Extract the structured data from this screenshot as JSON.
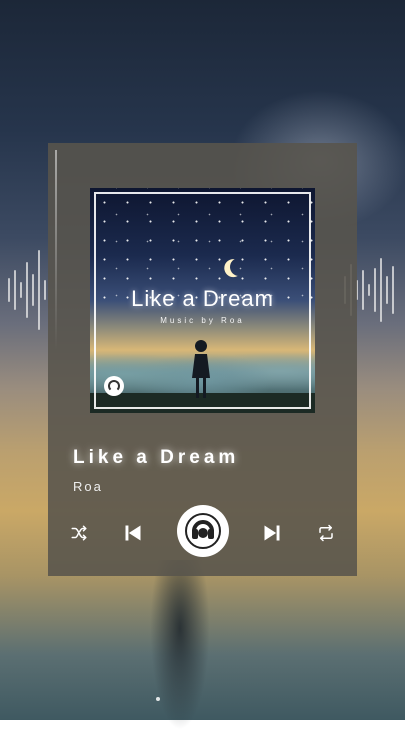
{
  "player": {
    "song_title": "Like a Dream",
    "artist": "Roa",
    "artwork": {
      "title": "Like a Dream",
      "subtitle": "Music by Roa"
    },
    "controls": {
      "shuffle_icon": "shuffle-icon",
      "previous_icon": "skip-previous-icon",
      "play_icon": "play-logo-icon",
      "next_icon": "skip-next-icon",
      "repeat_icon": "repeat-icon"
    }
  },
  "colors": {
    "card": "#58544c",
    "text": "#ffffff"
  }
}
